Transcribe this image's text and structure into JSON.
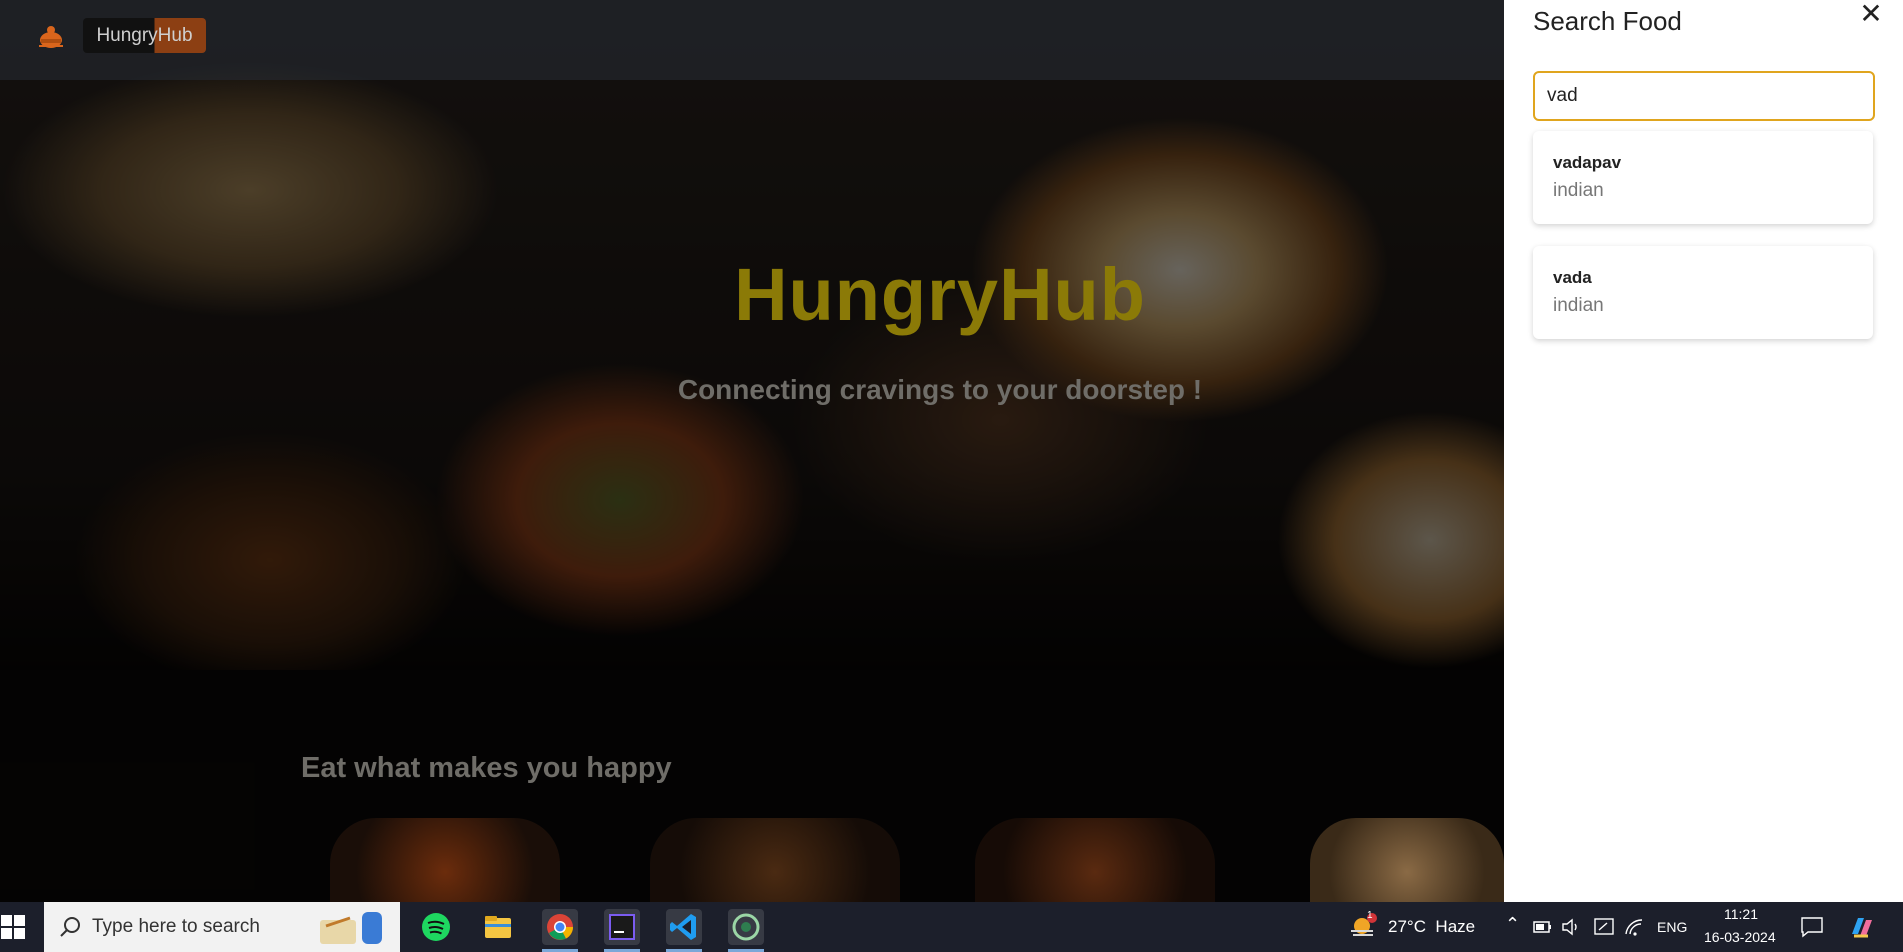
{
  "navbar": {
    "brand": "HungryHub"
  },
  "hero": {
    "title": "HungryHub",
    "subtitle": "Connecting cravings to your doorstep !"
  },
  "section": {
    "title": "Eat what makes you happy"
  },
  "drawer": {
    "title": "Search Food",
    "close_glyph": "✕",
    "search_value": "vad",
    "results": [
      {
        "name": "vadapav",
        "cuisine": "indian"
      },
      {
        "name": "vada",
        "cuisine": "indian"
      }
    ]
  },
  "taskbar": {
    "search_placeholder": "Type here to search",
    "weather": "27°C  Haze",
    "weather_badge": "1",
    "language": "ENG",
    "time": "11:21",
    "date": "16-03-2024",
    "apps": [
      "spotify-icon",
      "file-explorer-icon",
      "chrome-icon",
      "jetbrains-icon",
      "vscode-icon",
      "app-circle-icon"
    ]
  },
  "colors": {
    "hero_title": "#8b7a07",
    "accent_border": "#e0a51e",
    "taskbar_bg": "#1c1f2b"
  }
}
